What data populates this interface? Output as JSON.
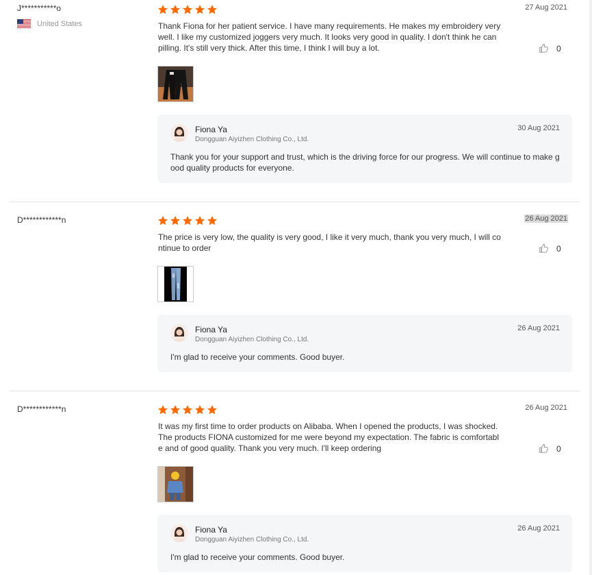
{
  "colors": {
    "star": "#ff6a00",
    "date_highlight": "#d9d9d9",
    "reply_bg": "#f5f6f8"
  },
  "reviews": [
    {
      "reviewer": "J***********o",
      "country": "United States",
      "rating": 5,
      "date": "27 Aug 2021",
      "comment": "Thank Fiona for her patient service. I have many requirements. He makes my embroidery very well. I like my customized joggers very much. It looks very good in quality. I don't think he can pilling. It's still very thick. After this time, I think I will buy a lot.",
      "likes": "0",
      "reply": {
        "name": "Fiona Ya",
        "company": "Dongguan Aiyizhen Clothing Co., Ltd.",
        "date": "30 Aug 2021",
        "text": "Thank you for your support and trust, which is the driving force for our progress. We will continue to make good quality products for everyone."
      }
    },
    {
      "reviewer": "D************n",
      "rating": 5,
      "date": "26 Aug 2021",
      "comment": "The price is very low, the quality is very good, I like it very much, thank you very much, I will continue to order",
      "likes": "0",
      "reply": {
        "name": "Fiona Ya",
        "company": "Dongguan Aiyizhen Clothing Co., Ltd.",
        "date": "26 Aug 2021",
        "text": "I'm glad to receive your comments. Good buyer."
      }
    },
    {
      "reviewer": "D************n",
      "rating": 5,
      "date": "26 Aug 2021",
      "comment": "It was my first time to order products on Alibaba. When I opened the products, I was shocked. The products FIONA customized for me were beyond my expectation. The fabric is comfortable and of good quality. Thank you very much. I'll keep ordering",
      "likes": "0",
      "reply": {
        "name": "Fiona Ya",
        "company": "Dongguan Aiyizhen Clothing Co., Ltd.",
        "date": "26 Aug 2021",
        "text": "I'm glad to receive your comments. Good buyer."
      }
    }
  ]
}
